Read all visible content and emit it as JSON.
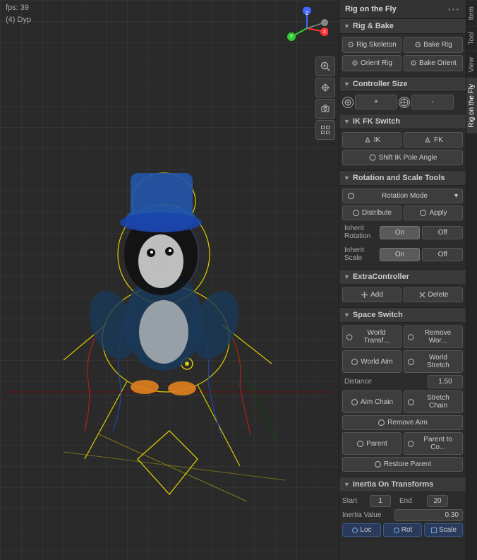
{
  "viewport": {
    "fps": "fps: 39",
    "bone_label": "(4) Dyp"
  },
  "panel": {
    "title": "Rig on the Fly",
    "dots": "···",
    "tabs": [
      {
        "label": "Item",
        "active": false
      },
      {
        "label": "Tool",
        "active": false
      },
      {
        "label": "View",
        "active": false
      },
      {
        "label": "Rig on the Fly",
        "active": true
      }
    ],
    "sections": {
      "rig_bake": {
        "header": "Rig & Bake",
        "rig_skeleton": "Rig Skeleton",
        "bake_rig": "Bake Rig",
        "orient_rig": "Orient Rig",
        "bake_orient": "Bake Orient"
      },
      "controller_size": {
        "header": "Controller Size",
        "plus": "+",
        "minus": "-"
      },
      "ik_fk_switch": {
        "header": "IK FK Switch",
        "ik": "IK",
        "fk": "FK",
        "shift_ik_pole": "Shift IK Pole Angle"
      },
      "rotation_scale": {
        "header": "Rotation and Scale Tools",
        "rotation_mode_label": "Rotation Mode",
        "distribute": "Distribute",
        "apply": "Apply",
        "inherit_rotation": "Inherit Rotation",
        "on1": "On",
        "off1": "Off",
        "inherit_scale": "Inherit Scale",
        "on2": "On",
        "off2": "Off"
      },
      "extra_controller": {
        "header": "ExtraController",
        "add": "Add",
        "delete": "Delete"
      },
      "space_switch": {
        "header": "Space Switch",
        "world_transf": "World Transf...",
        "remove_wor": "Remove Wor...",
        "world_aim": "World Aim",
        "world_stretch": "World Stretch",
        "distance_label": "Distance",
        "distance_value": "1.50",
        "aim_chain": "Aim Chain",
        "stretch_chain": "Stretch Chain",
        "remove_aim": "Remove Aim",
        "parent": "Parent",
        "parent_to_co": "Parent to Co...",
        "restore_parent": "Restore Parent"
      },
      "inertia": {
        "header": "Inertia On Transforms",
        "start_label": "Start",
        "start_value": "1",
        "end_label": "End",
        "end_value": "20",
        "inertia_value_label": "Inertia Value",
        "inertia_value": "0.30",
        "loc": "Loc",
        "rot": "Rot",
        "scale": "Scale"
      }
    }
  },
  "tools": {
    "zoom": "🔍",
    "pan": "✋",
    "camera": "📷",
    "grid": "⊞"
  }
}
